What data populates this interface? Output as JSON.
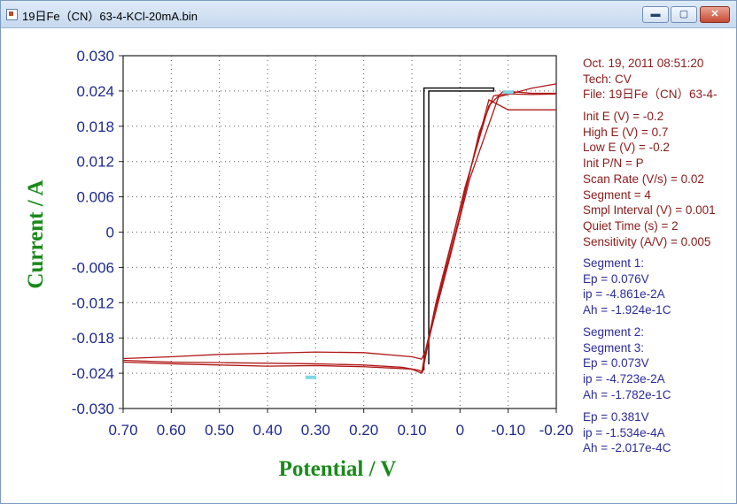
{
  "window": {
    "title": "19日Fe（CN）63-4-KCl-20mA.bin",
    "minimize_symbol": "▬",
    "restore_symbol": "▢",
    "close_symbol": "✕"
  },
  "info_panel": {
    "header": [
      "Oct. 19, 2011   08:51:20",
      "Tech: CV",
      "File: 19日Fe（CN）63-4-"
    ],
    "params": [
      "Init E (V) = -0.2",
      "High E (V) = 0.7",
      "Low E (V) = -0.2",
      "Init P/N = P",
      "Scan Rate (V/s) = 0.02",
      "Segment = 4",
      "Smpl Interval (V) = 0.001",
      "Quiet Time (s) = 2",
      "Sensitivity (A/V) = 0.005"
    ],
    "seg1": [
      "Segment 1:",
      "Ep = 0.076V",
      "ip = -4.861e-2A",
      "Ah = -1.924e-1C"
    ],
    "seg23": [
      "Segment 2:",
      "Segment 3:",
      "Ep = 0.073V",
      "ip = -4.723e-2A",
      "Ah = -1.782e-1C"
    ],
    "seg4": [
      "Ep = 0.381V",
      "ip = -1.534e-4A",
      "Ah = -2.017e-4C"
    ]
  },
  "colors": {
    "curve": "#b01818",
    "baseline": "#000000",
    "axis_text": "#1f2a8c",
    "axis_title": "#1a8a1a",
    "marker": "#7fd8e6"
  },
  "chart_data": {
    "type": "line",
    "xlabel": "Potential / V",
    "ylabel": "Current / A",
    "x_reversed": true,
    "xlim": [
      0.7,
      -0.2
    ],
    "ylim": [
      -0.03,
      0.03
    ],
    "x_ticks": [
      "0.70",
      "0.60",
      "0.50",
      "0.40",
      "0.30",
      "0.20",
      "0.10",
      "0",
      "-0.10",
      "-0.20"
    ],
    "y_ticks": [
      "0.030",
      "0.024",
      "0.018",
      "0.012",
      "0.006",
      "0",
      "-0.006",
      "-0.012",
      "-0.018",
      "-0.024",
      "-0.030"
    ],
    "grid": "dotted",
    "series": [
      {
        "x": [
          0.7,
          0.6,
          0.5,
          0.4,
          0.3,
          0.2,
          0.12,
          0.085,
          0.078,
          0.06,
          0.02,
          -0.02,
          -0.08,
          -0.15,
          -0.2
        ],
        "y": [
          -0.0218,
          -0.0221,
          -0.0222,
          -0.0223,
          -0.0224,
          -0.0226,
          -0.023,
          -0.0235,
          -0.0238,
          -0.0165,
          -0.004,
          0.009,
          0.023,
          0.0245,
          0.0252
        ]
      },
      {
        "x": [
          -0.2,
          -0.15,
          -0.1,
          -0.07,
          -0.04,
          0.0,
          0.04,
          0.07,
          0.08,
          0.1,
          0.2,
          0.3,
          0.4,
          0.5,
          0.6,
          0.7
        ],
        "y": [
          0.0235,
          0.0234,
          0.0235,
          0.0232,
          0.017,
          0.003,
          -0.01,
          -0.02,
          -0.0216,
          -0.0212,
          -0.0205,
          -0.0204,
          -0.0206,
          -0.0208,
          -0.0212,
          -0.0215
        ]
      },
      {
        "x": [
          0.7,
          0.6,
          0.5,
          0.4,
          0.3,
          0.2,
          0.1,
          0.08,
          0.07,
          0.03,
          -0.01,
          -0.06,
          -0.09,
          -0.15,
          -0.2
        ],
        "y": [
          -0.0221,
          -0.0224,
          -0.0226,
          -0.0228,
          -0.0227,
          -0.0229,
          -0.0233,
          -0.024,
          -0.0195,
          -0.006,
          0.0075,
          0.0215,
          0.024,
          0.0236,
          0.0236
        ]
      },
      {
        "x": [
          -0.2,
          -0.14,
          -0.1,
          -0.06,
          0.0,
          0.05,
          0.077
        ],
        "y": [
          0.0208,
          0.0208,
          0.0208,
          0.0225,
          0.004,
          -0.012,
          -0.0226
        ]
      }
    ],
    "baseline": {
      "x": [
        0.075,
        0.075,
        -0.07,
        -0.07,
        0.065,
        0.065
      ],
      "y": [
        -0.0235,
        0.0245,
        0.0245,
        0.024,
        0.024,
        -0.0225
      ]
    }
  }
}
